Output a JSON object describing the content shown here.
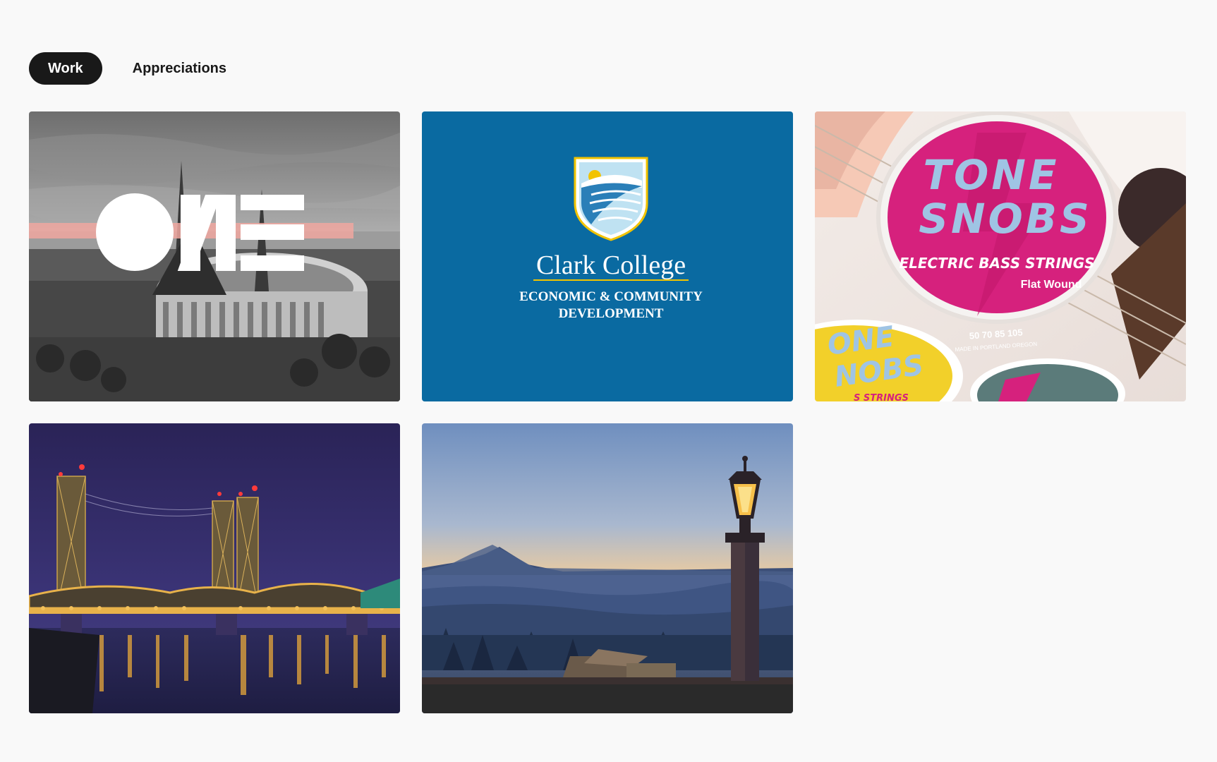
{
  "tabs": [
    {
      "label": "Work",
      "active": true
    },
    {
      "label": "Appreciations",
      "active": false
    }
  ],
  "projects": [
    {
      "thumb": "oregon-convention-center-one-graphic"
    },
    {
      "thumb": "clark-college-logo",
      "title": "Clark College",
      "subtitle_line1": "ECONOMIC & COMMUNITY",
      "subtitle_line2": "DEVELOPMENT",
      "bg_color": "#0a6aa1"
    },
    {
      "thumb": "tone-snobs-strings-package",
      "brand_line1": "TONE",
      "brand_line2": "SNOBS",
      "product": "ELECTRIC BASS STRINGS",
      "variant": "Flat Wound",
      "gauges": "50 70 85 105",
      "made_in": "MADE IN PORTLAND OREGON",
      "bottom_brand_line1": "ONE",
      "bottom_brand_line2": "NOBS",
      "bottom_product": "S STRINGS",
      "accent_color": "#d6217d"
    },
    {
      "thumb": "interstate-bridge-night-photo"
    },
    {
      "thumb": "mount-hood-sunset-illustration"
    }
  ]
}
